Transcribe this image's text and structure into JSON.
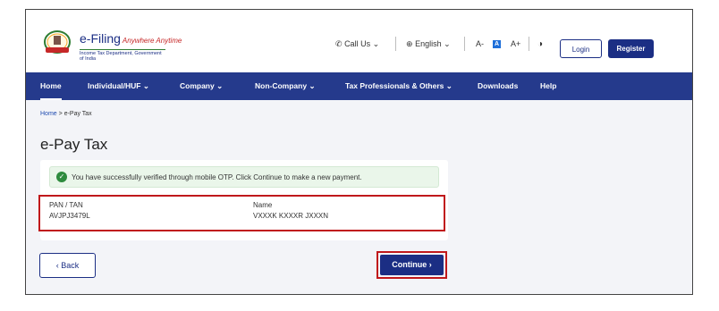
{
  "header": {
    "logo_title": "e-Filing",
    "logo_tagline": "Anywhere Anytime",
    "logo_subtitle": "Income Tax Department, Government of India",
    "call_us": "Call Us",
    "language": "English",
    "font_decrease": "A-",
    "font_normal": "A",
    "font_increase": "A+",
    "login_label": "Login",
    "register_label": "Register"
  },
  "nav": {
    "items": [
      {
        "label": "Home"
      },
      {
        "label": "Individual/HUF"
      },
      {
        "label": "Company"
      },
      {
        "label": "Non-Company"
      },
      {
        "label": "Tax Professionals & Others"
      },
      {
        "label": "Downloads"
      },
      {
        "label": "Help"
      }
    ]
  },
  "breadcrumb": {
    "home": "Home",
    "separator": ">",
    "current": "e-Pay Tax"
  },
  "page_title": "e-Pay Tax",
  "alert": {
    "message": "You have successfully verified through mobile OTP. Click Continue to make a new payment."
  },
  "details": {
    "pan_label": "PAN / TAN",
    "pan_value": "AVJPJ3479L",
    "name_label": "Name",
    "name_value": "VXXXK KXXXR JXXXN"
  },
  "actions": {
    "back_label": "Back",
    "continue_label": "Continue"
  },
  "colors": {
    "primary": "#1b2e84",
    "nav": "#253a8c",
    "highlight": "#c0181b",
    "success": "#2e8b3e"
  }
}
